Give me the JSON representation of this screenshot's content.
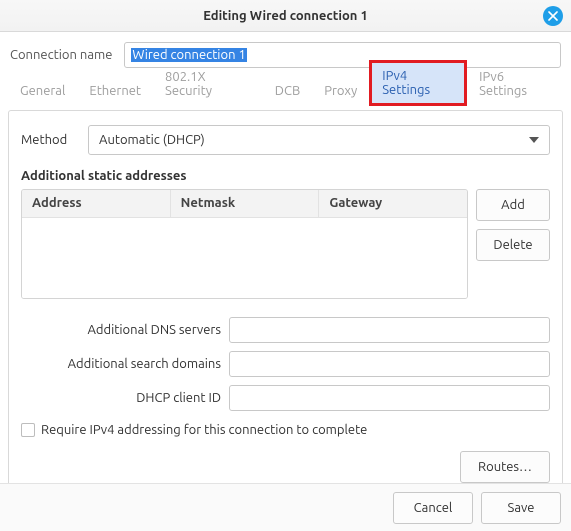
{
  "window": {
    "title": "Editing Wired connection 1"
  },
  "connection": {
    "name_label": "Connection name",
    "name_value": "Wired connection 1"
  },
  "tabs": {
    "general": "General",
    "ethernet": "Ethernet",
    "security": "802.1X Security",
    "dcb": "DCB",
    "proxy": "Proxy",
    "ipv4": "IPv4 Settings",
    "ipv6": "IPv6 Settings",
    "active": "ipv4"
  },
  "ipv4": {
    "method_label": "Method",
    "method_value": "Automatic (DHCP)",
    "additional_addresses_title": "Additional static addresses",
    "cols": {
      "address": "Address",
      "netmask": "Netmask",
      "gateway": "Gateway"
    },
    "rows": [],
    "btn_add": "Add",
    "btn_delete": "Delete",
    "dns_label": "Additional DNS servers",
    "dns_value": "",
    "search_label": "Additional search domains",
    "search_value": "",
    "dhcp_client_label": "DHCP client ID",
    "dhcp_client_value": "",
    "require_label": "Require IPv4 addressing for this connection to complete",
    "require_checked": false,
    "routes_btn": "Routes…"
  },
  "footer": {
    "cancel": "Cancel",
    "save": "Save"
  }
}
